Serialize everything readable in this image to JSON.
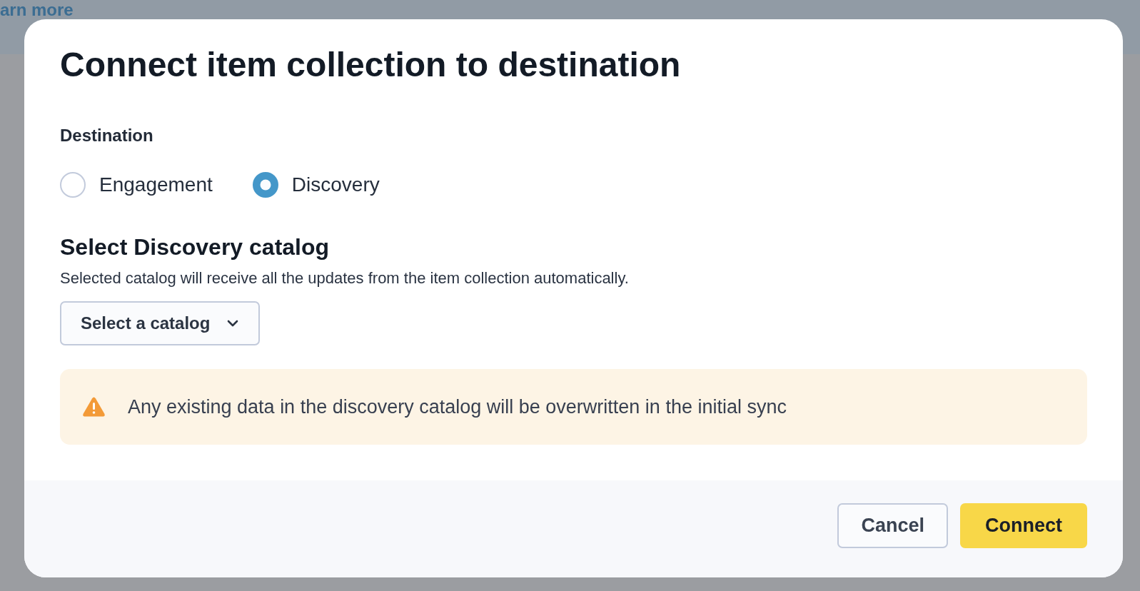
{
  "background_page": {
    "link": "arn more"
  },
  "dialog": {
    "title": "Connect item collection to destination",
    "destination": {
      "label": "Destination",
      "options": [
        {
          "label": "Engagement",
          "selected": false
        },
        {
          "label": "Discovery",
          "selected": true
        }
      ]
    },
    "catalog_section": {
      "heading": "Select Discovery catalog",
      "description": "Selected catalog will receive all the updates from the item collection automatically.",
      "dropdown": {
        "label": "Select a catalog"
      }
    },
    "alert": {
      "kind": "warning",
      "message": "Any existing data in the discovery catalog will be overwritten in the initial sync"
    },
    "buttons": [
      {
        "label": "Cancel",
        "kind": "secondary"
      },
      {
        "label": "Connect",
        "kind": "primary"
      }
    ]
  }
}
